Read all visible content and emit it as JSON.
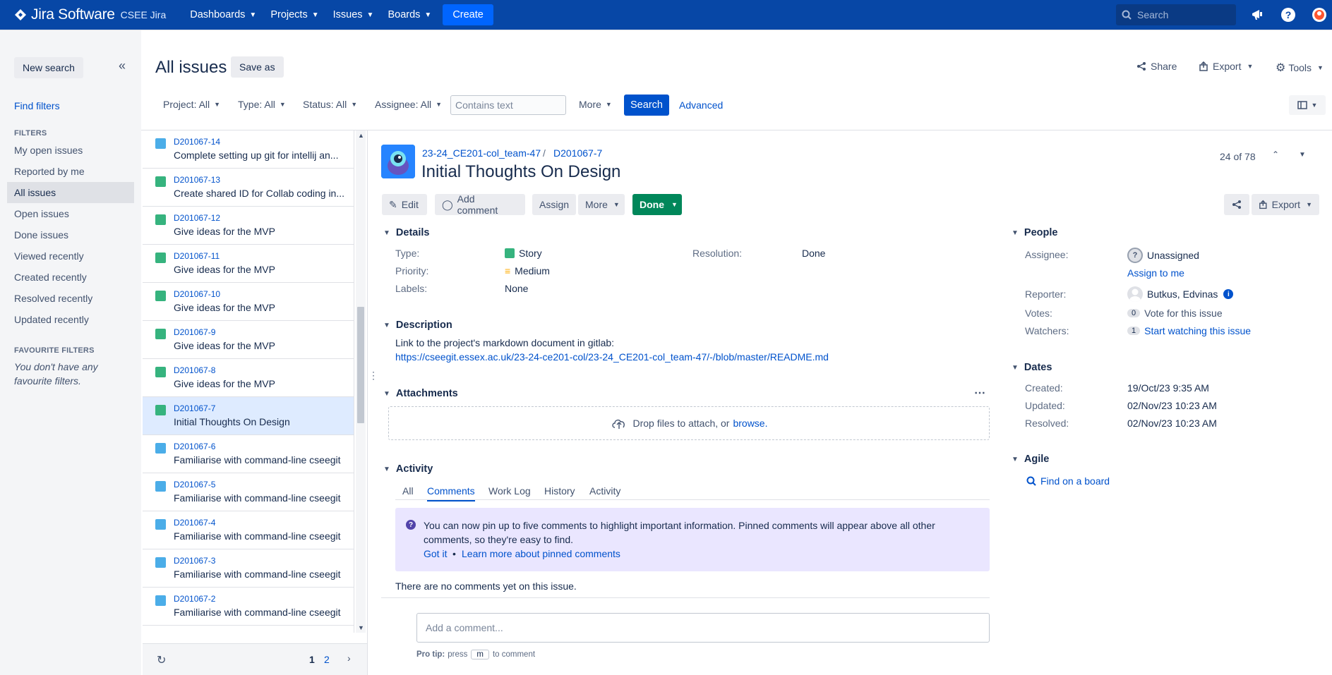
{
  "topnav": {
    "brand": "Jira Software",
    "instance": "CSEE Jira",
    "items": [
      {
        "label": "Dashboards"
      },
      {
        "label": "Projects"
      },
      {
        "label": "Issues"
      },
      {
        "label": "Boards"
      }
    ],
    "create_label": "Create",
    "search_placeholder": "Search"
  },
  "sidebar": {
    "new_search": "New search",
    "find_filters": "Find filters",
    "filters_heading": "FILTERS",
    "items": [
      {
        "label": "My open issues"
      },
      {
        "label": "Reported by me"
      },
      {
        "label": "All issues"
      },
      {
        "label": "Open issues"
      },
      {
        "label": "Done issues"
      },
      {
        "label": "Viewed recently"
      },
      {
        "label": "Created recently"
      },
      {
        "label": "Resolved recently"
      },
      {
        "label": "Updated recently"
      }
    ],
    "favourite_heading": "FAVOURITE FILTERS",
    "favourite_empty": "You don't have any favourite filters."
  },
  "header": {
    "title": "All issues",
    "save_as": "Save as",
    "share": "Share",
    "export": "Export",
    "tools": "Tools"
  },
  "filters": {
    "project": "Project: All",
    "type": "Type: All",
    "status": "Status: All",
    "assignee": "Assignee: All",
    "contains_placeholder": "Contains text",
    "more": "More",
    "search": "Search",
    "advanced": "Advanced"
  },
  "issues": [
    {
      "key": "D201067-14",
      "summary": "Complete setting up git for intellij an...",
      "type": "task"
    },
    {
      "key": "D201067-13",
      "summary": "Create shared ID for Collab coding in...",
      "type": "story"
    },
    {
      "key": "D201067-12",
      "summary": "Give ideas for the MVP",
      "type": "story"
    },
    {
      "key": "D201067-11",
      "summary": "Give ideas for the MVP",
      "type": "story"
    },
    {
      "key": "D201067-10",
      "summary": "Give ideas for the MVP",
      "type": "story"
    },
    {
      "key": "D201067-9",
      "summary": "Give ideas for the MVP",
      "type": "story"
    },
    {
      "key": "D201067-8",
      "summary": "Give ideas for the MVP",
      "type": "story"
    },
    {
      "key": "D201067-7",
      "summary": "Initial Thoughts On Design",
      "type": "story"
    },
    {
      "key": "D201067-6",
      "summary": "Familiarise with command-line cseegit",
      "type": "task"
    },
    {
      "key": "D201067-5",
      "summary": "Familiarise with command-line cseegit",
      "type": "task"
    },
    {
      "key": "D201067-4",
      "summary": "Familiarise with command-line cseegit",
      "type": "task"
    },
    {
      "key": "D201067-3",
      "summary": "Familiarise with command-line cseegit",
      "type": "task"
    },
    {
      "key": "D201067-2",
      "summary": "Familiarise with command-line cseegit",
      "type": "task"
    }
  ],
  "pagination": {
    "page1": "1",
    "page2": "2"
  },
  "issue": {
    "project_link": "23-24_CE201-col_team-47",
    "sep": "/",
    "key": "D201067-7",
    "title": "Initial Thoughts On Design",
    "position": "24 of 78",
    "toolbar": {
      "edit": "Edit",
      "add_comment": "Add comment",
      "assign": "Assign",
      "more": "More",
      "status": "Done",
      "export": "Export"
    },
    "details": {
      "heading": "Details",
      "type_label": "Type:",
      "type_value": "Story",
      "priority_label": "Priority:",
      "priority_value": "Medium",
      "labels_label": "Labels:",
      "labels_value": "None",
      "resolution_label": "Resolution:",
      "resolution_value": "Done"
    },
    "description": {
      "heading": "Description",
      "text": "Link to the project's markdown document in gitlab:",
      "link": "https://cseegit.essex.ac.uk/23-24-ce201-col/23-24_CE201-col_team-47/-/blob/master/README.md"
    },
    "attachments": {
      "heading": "Attachments",
      "drop_text": "Drop files to attach, or",
      "browse": "browse."
    },
    "activity": {
      "heading": "Activity",
      "tabs": [
        "All",
        "Comments",
        "Work Log",
        "History",
        "Activity"
      ],
      "info_text_1": "You can now pin up to five comments to highlight important information. Pinned comments will appear above all other",
      "info_text_2": "comments, so they're easy to find.",
      "got_it": "Got it",
      "bullet": "•",
      "learn_more": "Learn more about pinned comments",
      "no_comments": "There are no comments yet on this issue.",
      "add_comment_placeholder": "Add a comment...",
      "pro_tip_label": "Pro tip:",
      "pro_tip_press": "press",
      "pro_tip_key": "m",
      "pro_tip_rest": "to comment"
    },
    "people": {
      "heading": "People",
      "assignee_label": "Assignee:",
      "assignee_value": "Unassigned",
      "assign_to_me": "Assign to me",
      "reporter_label": "Reporter:",
      "reporter_value": "Butkus, Edvinas",
      "votes_label": "Votes:",
      "votes_count": "0",
      "vote_link": "Vote for this issue",
      "watchers_label": "Watchers:",
      "watchers_count": "1",
      "watch_link": "Start watching this issue"
    },
    "dates": {
      "heading": "Dates",
      "created_label": "Created:",
      "created_value": "19/Oct/23 9:35 AM",
      "updated_label": "Updated:",
      "updated_value": "02/Nov/23 10:23 AM",
      "resolved_label": "Resolved:",
      "resolved_value": "02/Nov/23 10:23 AM"
    },
    "agile": {
      "heading": "Agile",
      "find_on_board": "Find on a board"
    }
  },
  "colors": {
    "nav_bg": "#0747a6",
    "primary": "#0052cc",
    "done_green": "#00875a",
    "info_bg": "#eae6ff",
    "selected_row": "#deebff"
  }
}
